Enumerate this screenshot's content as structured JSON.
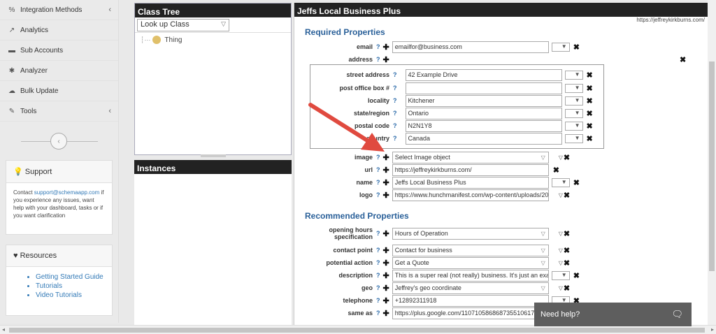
{
  "sidebar": {
    "items": [
      {
        "label": "Integration Methods",
        "icon": "link-icon",
        "glyph": "%",
        "chevron": "‹"
      },
      {
        "label": "Analytics",
        "icon": "chart-icon",
        "glyph": "↗",
        "chevron": ""
      },
      {
        "label": "Sub Accounts",
        "icon": "folder-icon",
        "glyph": "▬",
        "chevron": ""
      },
      {
        "label": "Analyzer",
        "icon": "bug-icon",
        "glyph": "✱",
        "chevron": ""
      },
      {
        "label": "Bulk Update",
        "icon": "cloud-upload-icon",
        "glyph": "☁",
        "chevron": ""
      },
      {
        "label": "Tools",
        "icon": "wrench-icon",
        "glyph": "✎",
        "chevron": "‹"
      }
    ],
    "collapse": "‹"
  },
  "support": {
    "title": "Support",
    "text_before": "Contact ",
    "email": "support@schemaapp.com",
    "text_after": " if you experience any issues, want help with your dashboard, tasks or if you want clarification"
  },
  "resources": {
    "title": "Resources",
    "links": [
      "Getting Started Guide",
      "Tutorials",
      "Video Tutorials"
    ]
  },
  "class_tree": {
    "title": "Class Tree",
    "lookup": "Look up Class",
    "root": "Thing"
  },
  "instances": {
    "title": "Instances"
  },
  "editor": {
    "title": "Jeffs Local Business Plus",
    "site_url": "https://jeffreykirkburns.com/",
    "required_title": "Required Properties",
    "recommended_title": "Recommended Properties",
    "q": "?",
    "plus": "✚",
    "x": "✖",
    "email": {
      "label": "email",
      "value": "emailfor@business.com"
    },
    "address": {
      "label": "address"
    },
    "address_fields": [
      {
        "label": "street address",
        "value": "42 Example Drive"
      },
      {
        "label": "post office box #",
        "value": ""
      },
      {
        "label": "locality",
        "value": "Kitchener"
      },
      {
        "label": "state/region",
        "value": "Ontario"
      },
      {
        "label": "postal code",
        "value": "N2N1Y8"
      },
      {
        "label": "country",
        "value": "Canada"
      }
    ],
    "image": {
      "label": "image",
      "value": "Select Image object"
    },
    "url": {
      "label": "url",
      "value": "https://jeffreykirkburns.com/"
    },
    "name": {
      "label": "name",
      "value": "Jeffs Local Business Plus"
    },
    "logo": {
      "label": "logo",
      "value": "https://www.hunchmanifest.com/wp-content/uploads/20"
    },
    "recommended": [
      {
        "label": "opening hours specification",
        "value": "Hours of Operation",
        "kind": "select"
      },
      {
        "label": "contact point",
        "value": "Contact for business",
        "kind": "select"
      },
      {
        "label": "potential action",
        "value": "Get a Quote",
        "kind": "select"
      },
      {
        "label": "description",
        "value": "This is a super real (not really) business. It's just an exa",
        "kind": "text"
      },
      {
        "label": "geo",
        "value": "Jeffrey's geo coordinate",
        "kind": "select"
      },
      {
        "label": "telephone",
        "value": "+12892311918",
        "kind": "text"
      },
      {
        "label": "same as",
        "value": "https://plus.google.com/110710586868735510617",
        "kind": "text"
      }
    ]
  },
  "help": {
    "label": "Need help?"
  },
  "colors": {
    "accent": "#2a6099",
    "arrow": "#e04a3f",
    "header": "#222222"
  }
}
